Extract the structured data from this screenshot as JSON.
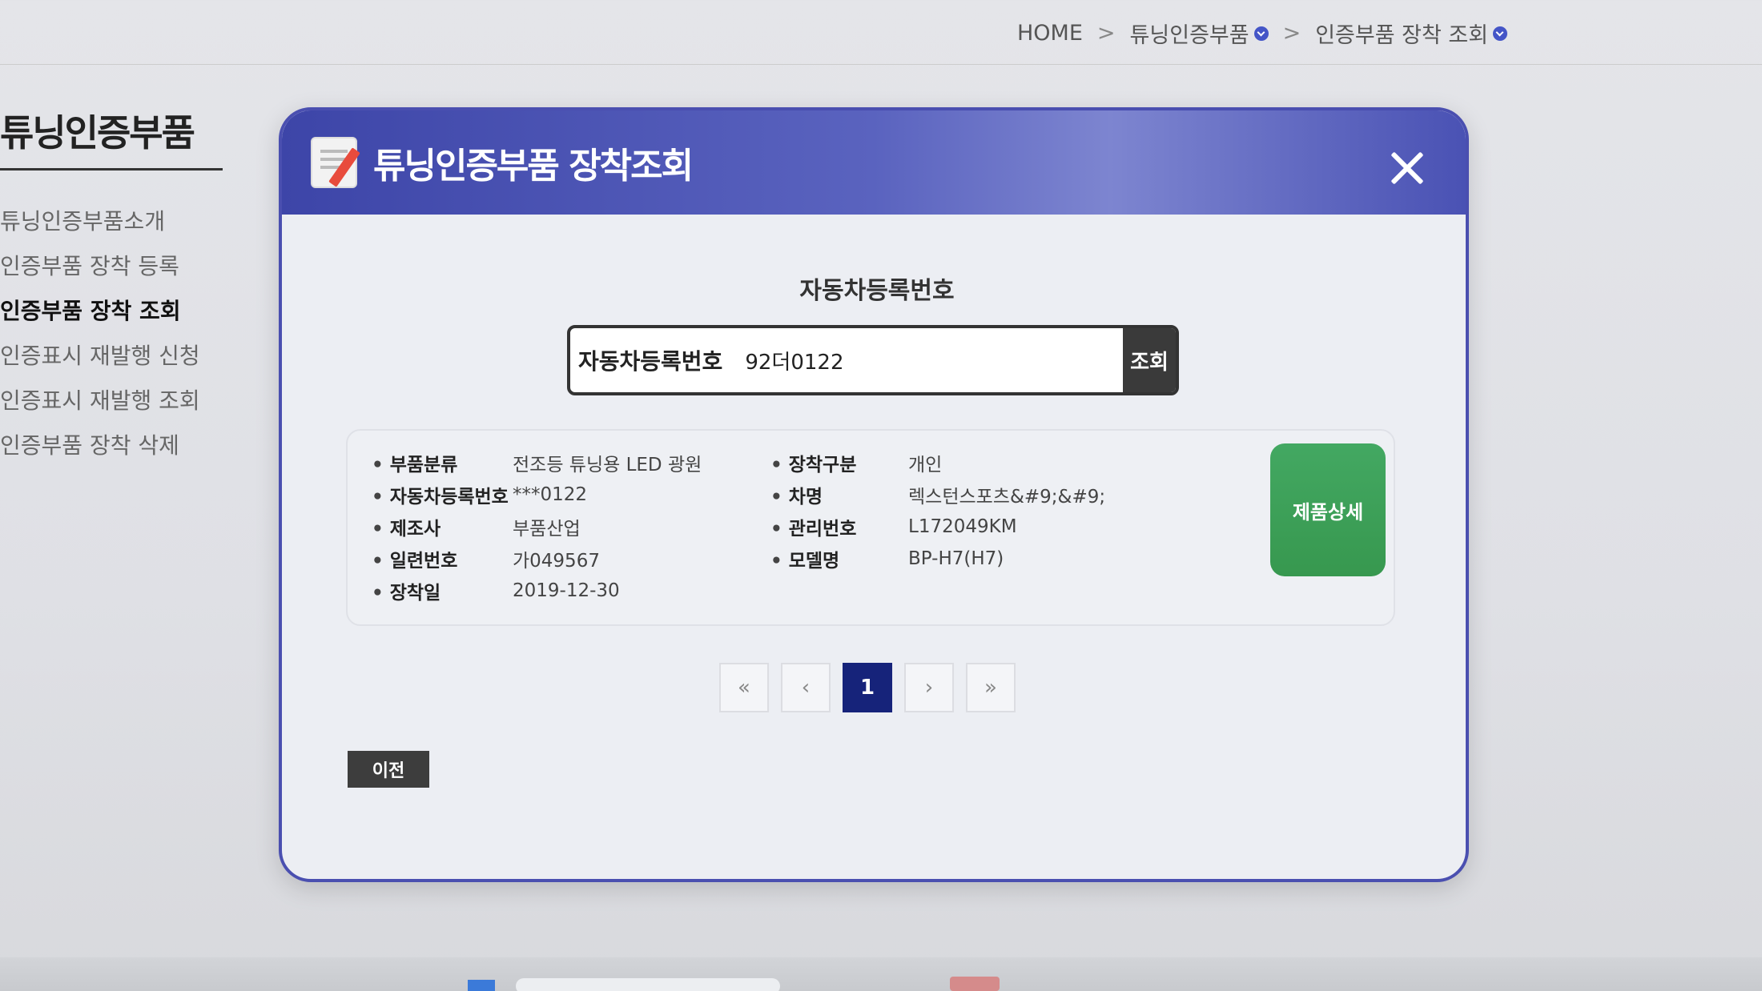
{
  "breadcrumb": {
    "home": "HOME",
    "separator": ">",
    "level1": "튜닝인증부품",
    "level2": "인증부품 장착 조회"
  },
  "sidebar": {
    "title": "튜닝인증부품",
    "items": [
      {
        "label": "튜닝인증부품소개"
      },
      {
        "label": "인증부품 장착 등록"
      },
      {
        "label": "인증부품 장착 조회"
      },
      {
        "label": "인증표시 재발행 신청"
      },
      {
        "label": "인증표시 재발행 조회"
      },
      {
        "label": "인증부품 장착 삭제"
      }
    ]
  },
  "modal": {
    "title": "튜닝인증부품 장착조회",
    "close_icon": "close-icon",
    "search_heading": "자동차등록번호",
    "search": {
      "label": "자동차등록번호",
      "value": "92더0122",
      "button": "조회"
    },
    "result": {
      "left": [
        {
          "label": "부품분류",
          "value": "전조등 튜닝용 LED 광원"
        },
        {
          "label": "자동차등록번호",
          "value": "***0122"
        },
        {
          "label": "제조사",
          "value": "부품산업"
        },
        {
          "label": "일련번호",
          "value": "가049567"
        },
        {
          "label": "장착일",
          "value": "2019-12-30"
        }
      ],
      "right": [
        {
          "label": "장착구분",
          "value": "개인"
        },
        {
          "label": "차명",
          "value": "렉스턴스포츠&#9;&#9;"
        },
        {
          "label": "관리번호",
          "value": "L172049KM"
        },
        {
          "label": "모델명",
          "value": "BP-H7(H7)"
        }
      ],
      "detail_button": "제품상세"
    },
    "pagination": {
      "first": "«",
      "prev": "‹",
      "current": "1",
      "next": "›",
      "last": "»"
    },
    "prev_button": "이전"
  },
  "colors": {
    "header": "#3d45a8",
    "accent_green": "#3aa058",
    "page_current": "#16237a"
  }
}
